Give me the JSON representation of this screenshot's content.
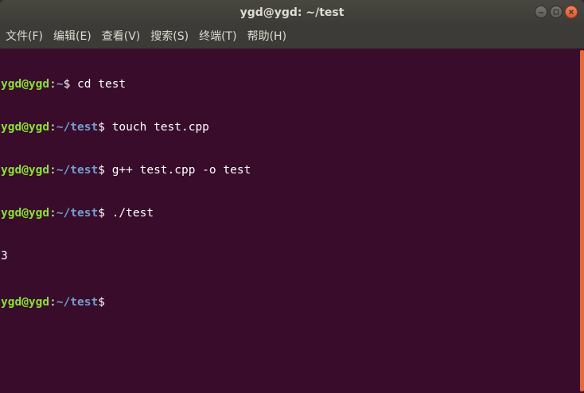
{
  "window": {
    "title": "ygd@ygd: ~/test",
    "buttons": [
      "minimize-icon",
      "maximize-icon",
      "close-icon"
    ]
  },
  "menu": {
    "file": "文件(F)",
    "edit": "编辑(E)",
    "view": "查看(V)",
    "search": "搜索(S)",
    "terminal": "终端(T)",
    "help": "帮助(H)"
  },
  "terminal": {
    "lines": [
      {
        "user": "ygd@ygd",
        "colon": ":",
        "path": "~",
        "dollar": "$",
        "cmd": " cd test"
      },
      {
        "user": "ygd@ygd",
        "colon": ":",
        "path": "~/test",
        "dollar": "$",
        "cmd": " touch test.cpp"
      },
      {
        "user": "ygd@ygd",
        "colon": ":",
        "path": "~/test",
        "dollar": "$",
        "cmd": " g++ test.cpp -o test"
      },
      {
        "user": "ygd@ygd",
        "colon": ":",
        "path": "~/test",
        "dollar": "$",
        "cmd": " ./test"
      }
    ],
    "output": "3",
    "prompt": {
      "user": "ygd@ygd",
      "colon": ":",
      "path": "~/test",
      "dollar": "$"
    }
  },
  "colors": {
    "background": "#380c2a",
    "user_host": "#8ae234",
    "path": "#729fcf",
    "text": "#ffffff",
    "scrollbar": "#e26b3a"
  }
}
